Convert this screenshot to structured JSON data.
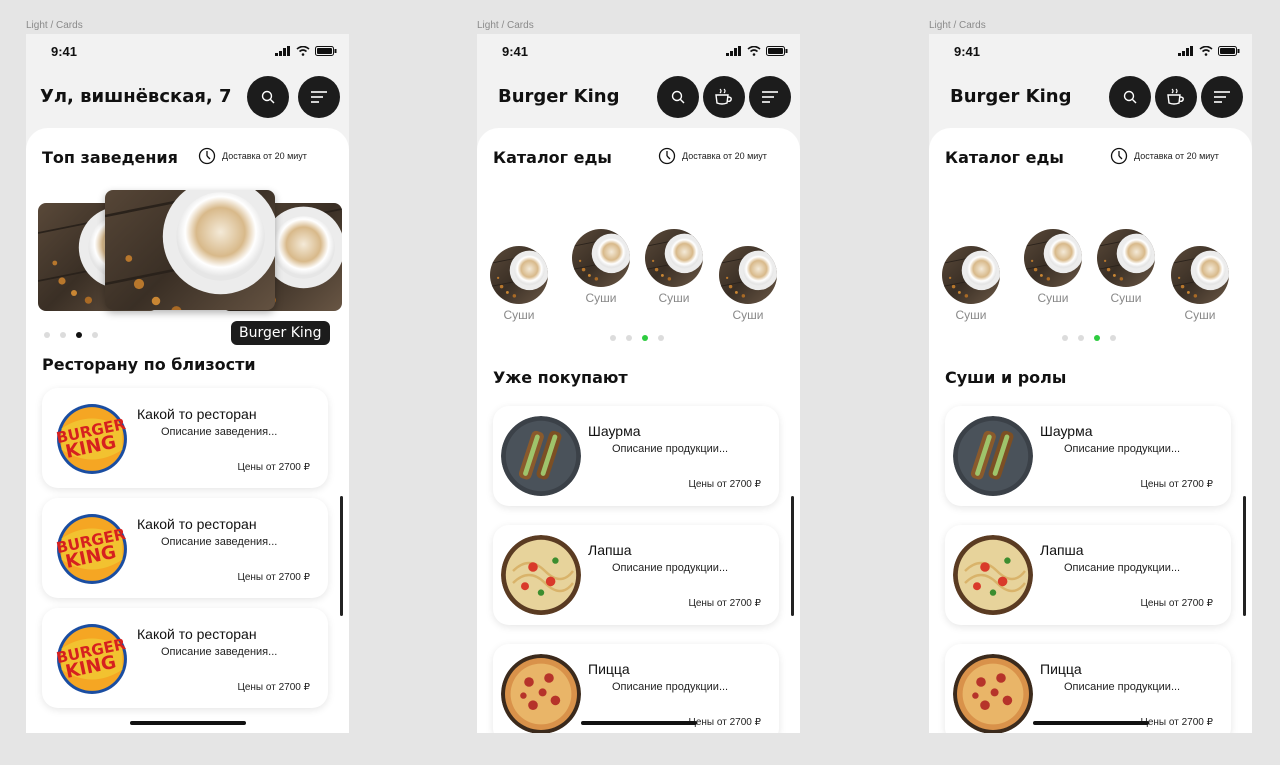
{
  "frame_label": "Light / Cards",
  "status_time": "9:41",
  "screens": [
    {
      "header_title": "Ул, вишнёвская, 7",
      "section_title": "Топ заведения",
      "delivery_text": "Доставка от 20 миут",
      "brand_tag": "Burger King",
      "nearby_title": "Ресторану по близости",
      "restaurants": [
        {
          "name": "Какой то ресторан",
          "desc": "Описание заведения...",
          "price": "Цены от 2700 ₽"
        },
        {
          "name": "Какой то ресторан",
          "desc": "Описание заведения...",
          "price": "Цены от 2700 ₽"
        },
        {
          "name": "Какой то ресторан",
          "desc": "Описание заведения...",
          "price": "Цены от 2700 ₽"
        }
      ]
    },
    {
      "header_title": "Burger King",
      "section_title": "Каталог еды",
      "delivery_text": "Доставка от 20 миут",
      "categories": [
        "Суши",
        "Суши",
        "Суши",
        "Суши"
      ],
      "list_title": "Уже покупают",
      "items": [
        {
          "name": "Шаурма",
          "desc": "Описание продукции...",
          "price": "Цены от 2700 ₽"
        },
        {
          "name": "Лапша",
          "desc": "Описание продукции...",
          "price": "Цены от 2700 ₽"
        },
        {
          "name": "Пицца",
          "desc": "Описание продукции...",
          "price": "Цены от 2700 ₽"
        }
      ]
    },
    {
      "header_title": "Burger King",
      "section_title": "Каталог еды",
      "delivery_text": "Доставка от 20 миут",
      "categories": [
        "Суши",
        "Суши",
        "Суши",
        "Суши"
      ],
      "list_title": "Суши и ролы",
      "items": [
        {
          "name": "Шаурма",
          "desc": "Описание продукции...",
          "price": "Цены от 2700 ₽"
        },
        {
          "name": "Лапша",
          "desc": "Описание продукции...",
          "price": "Цены от 2700 ₽"
        },
        {
          "name": "Пицца",
          "desc": "Описание продукции...",
          "price": "Цены от 2700 ₽"
        }
      ]
    }
  ],
  "icons": {
    "search": "search-icon",
    "menu": "menu-icon",
    "coffee": "coffee-cup-icon",
    "clock": "clock-icon"
  },
  "colors": {
    "button_dark": "#1c1c1c",
    "dot_active_green": "#2ecc40",
    "background": "#e5e5e5"
  }
}
